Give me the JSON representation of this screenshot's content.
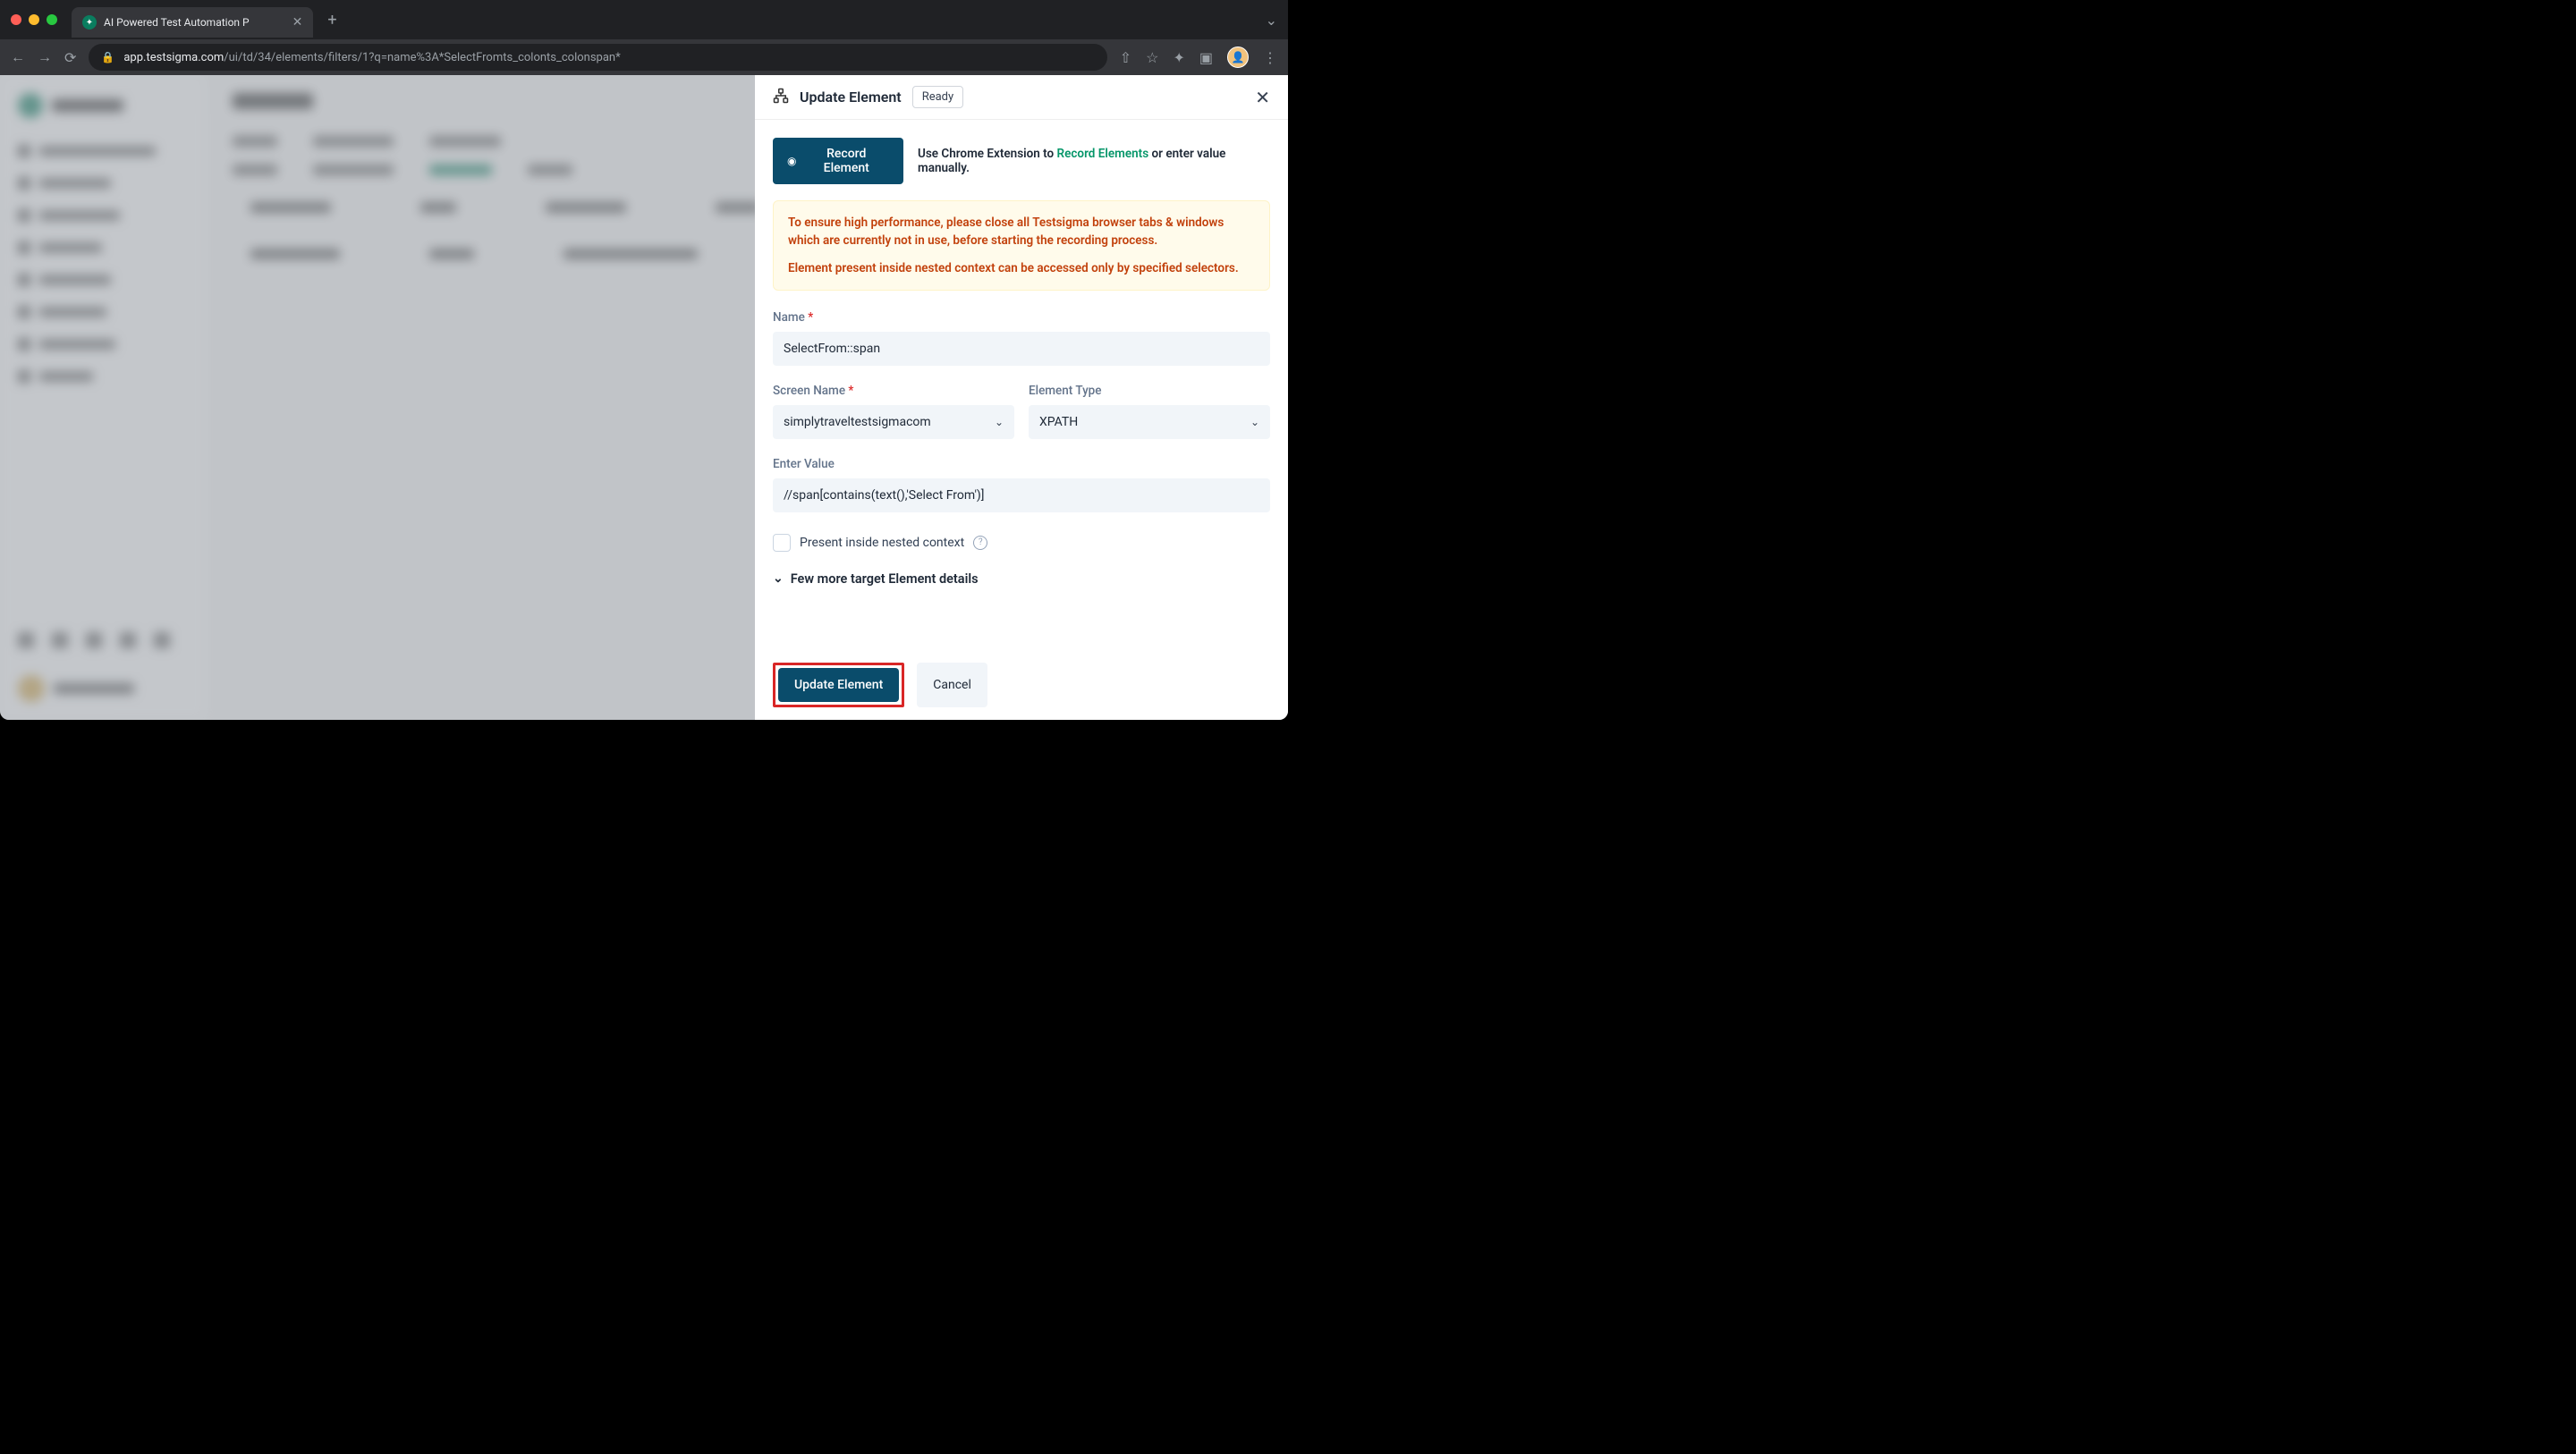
{
  "browser": {
    "tab_title": "AI Powered Test Automation P",
    "url_host": "app.testsigma.com",
    "url_path": "/ui/td/34/elements/filters/1?q=name%3A*SelectFromts_colonts_colonspan*"
  },
  "panel": {
    "title": "Update Element",
    "badge": "Ready",
    "record_button": "Record Element",
    "record_text_prefix": "Use Chrome Extension to ",
    "record_link": "Record Elements",
    "record_text_suffix": " or enter value manually.",
    "warning1": "To ensure high performance, please close all Testsigma browser tabs & windows which are currently not in use, before starting the recording process.",
    "warning2": "Element present inside nested context can be accessed only by specified selectors.",
    "name_label": "Name",
    "name_value": "SelectFrom::span",
    "screen_name_label": "Screen Name",
    "screen_name_value": "simplytraveltestsigmacom",
    "element_type_label": "Element Type",
    "element_type_value": "XPATH",
    "enter_value_label": "Enter Value",
    "enter_value_value": "//span[contains(text(),'Select From')]",
    "nested_context_label": "Present inside nested context",
    "expand_label": "Few more target Element details",
    "update_button": "Update Element",
    "cancel_button": "Cancel"
  }
}
